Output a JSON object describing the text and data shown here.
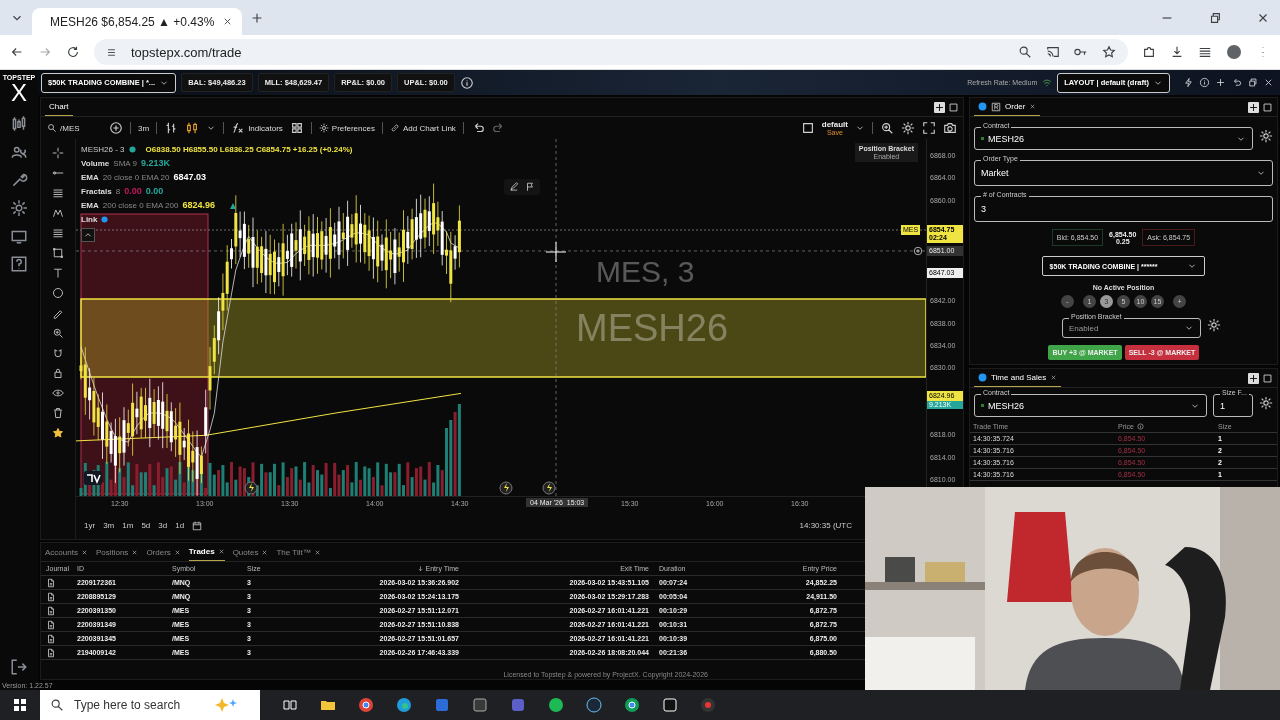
{
  "browser": {
    "tab": {
      "title": "MESH26 $6,854.25 ▲ +0.43%",
      "selected": true
    },
    "url": "topstepx.com/trade"
  },
  "topbar": {
    "logo_word": "TOPSTEP",
    "logo_letter": "X",
    "account": "$50K TRADING COMBINE | *...",
    "stats": [
      "BAL: $49,486.23",
      "MLL: $48,629.47",
      "RP&L: $0.00",
      "UP&L: $0.00"
    ],
    "refresh_rate": "Refresh Rate: Medium",
    "layout": "LAYOUT | default (draft)"
  },
  "chart": {
    "tab": {
      "label": "Chart",
      "selected": true
    },
    "symbol": "/MES",
    "interval": "3m",
    "indicators_button": "Indicators",
    "preferences_button": "Preferences",
    "chart_link_button": "Add Chart Link",
    "template": "default",
    "template_action": "Save",
    "title": "MESH26 - 3",
    "ohlc": "O6838.50 H6855.50 L6836.25 C6854.75 +16.25 (+0.24%)",
    "studies": [
      {
        "name": "Volume",
        "params": "SMA 9",
        "values": [
          {
            "text": "9.213K",
            "color": "#26a69a"
          }
        ]
      },
      {
        "name": "EMA",
        "params": "20 close 0 EMA 20",
        "values": [
          {
            "text": "6847.03",
            "color": "#ffffff"
          }
        ]
      },
      {
        "name": "Fractals",
        "params": "8",
        "values": [
          {
            "text": "0.00",
            "color": "#c2185b"
          },
          {
            "text": "0.00",
            "color": "#26a69a"
          }
        ]
      },
      {
        "name": "EMA",
        "params": "200 close 0 EMA 200",
        "values": [
          {
            "text": "6824.96",
            "color": "#f0e442"
          }
        ]
      }
    ],
    "link": "Link",
    "watermark": [
      "MES, 3",
      "MESH26"
    ],
    "bracket_title": "Position Bracket",
    "bracket_state": "Enabled",
    "price_ticks": [
      "6868.00",
      "6864.00",
      "6860.00",
      "6842.00",
      "6838.00",
      "6834.00",
      "6830.00",
      "6818.00",
      "6814.00",
      "6810.00"
    ],
    "price_tags": [
      {
        "kind": "last",
        "text": "6854.75",
        "sub": "02:24",
        "badge": "MES"
      },
      {
        "kind": "crosshair",
        "text": "6851.00"
      },
      {
        "kind": "ema",
        "text": "6847.03"
      },
      {
        "kind": "volume",
        "text": "6824.96",
        "sub": "9.213K"
      }
    ],
    "time_ticks": [
      "12:30",
      "13:00",
      "13:30",
      "14:00",
      "14:30",
      "15:30",
      "16:00",
      "16:30"
    ],
    "crosshair_time": "04 Mar '26  15:03",
    "ranges": [
      "1yr",
      "3m",
      "1m",
      "5d",
      "3d",
      "1d"
    ],
    "clock": "14:30:35 (UTC"
  },
  "order": {
    "tab": {
      "label": "Order",
      "selected": true
    },
    "contract_label": "Contract",
    "contract": "MESH26",
    "order_type_label": "Order Type",
    "order_type": "Market",
    "qty_label": "# of Contracts",
    "qty": "3",
    "bid": "Bid: 6,854.50",
    "last": "6,854.50",
    "spread": "0.25",
    "ask": "Ask: 6,854.75",
    "account": "$50K TRADING COMBINE | ******",
    "position": "No Active Position",
    "chips": [
      {
        "label": "-",
        "kind": "step",
        "selected": false
      },
      {
        "label": "1",
        "kind": "size",
        "selected": false
      },
      {
        "label": "3",
        "kind": "size",
        "selected": true
      },
      {
        "label": "5",
        "kind": "size",
        "selected": false
      },
      {
        "label": "10",
        "kind": "size",
        "selected": false
      },
      {
        "label": "15",
        "kind": "size",
        "selected": false
      },
      {
        "label": "+",
        "kind": "step",
        "selected": false
      }
    ],
    "bracket_label": "Position Bracket",
    "bracket": "Enabled",
    "buy": "BUY +3 @ MARKET",
    "sell": "SELL -3 @ MARKET"
  },
  "time_sales": {
    "tab": {
      "label": "Time and Sales",
      "selected": true
    },
    "contract_label": "Contract",
    "contract": "MESH26",
    "size_label": "Size F...",
    "size": "1",
    "columns": [
      "Trade Time",
      "Price",
      "Size"
    ],
    "rows": [
      [
        "14:30:35.724",
        "6,854.50",
        "1"
      ],
      [
        "14:30:35.716",
        "6,854.50",
        "2"
      ],
      [
        "14:30:35.716",
        "6,854.50",
        "2"
      ],
      [
        "14:30:35.716",
        "6,854.50",
        "1"
      ]
    ]
  },
  "bottom": {
    "tabs": [
      {
        "label": "Accounts",
        "selected": false
      },
      {
        "label": "Positions",
        "selected": false
      },
      {
        "label": "Orders",
        "selected": false
      },
      {
        "label": "Trades",
        "selected": true
      },
      {
        "label": "Quotes",
        "selected": false
      },
      {
        "label": "The Tilt™",
        "selected": false
      }
    ],
    "journal_column": "Journal",
    "columns": [
      "ID",
      "Symbol",
      "Size",
      "Entry Time",
      "Exit Time",
      "Duration",
      "Entry Price"
    ],
    "rows": [
      [
        "2209172361",
        "/MNQ",
        "3",
        "2026-03-02 15:36:26.902",
        "2026-03-02 15:43:51.105",
        "00:07:24",
        "24,852.25"
      ],
      [
        "2208895129",
        "/MNQ",
        "3",
        "2026-03-02 15:24:13.175",
        "2026-03-02 15:29:17.283",
        "00:05:04",
        "24,911.50"
      ],
      [
        "2200391350",
        "/MES",
        "3",
        "2026-02-27 15:51:12.071",
        "2026-02-27 16:01:41.221",
        "00:10:29",
        "6,872.75"
      ],
      [
        "2200391349",
        "/MES",
        "3",
        "2026-02-27 15:51:10.838",
        "2026-02-27 16:01:41.221",
        "00:10:31",
        "6,872.75"
      ],
      [
        "2200391345",
        "/MES",
        "3",
        "2026-02-27 15:51:01.657",
        "2026-02-27 16:01:41.221",
        "00:10:39",
        "6,875.00"
      ],
      [
        "2194009142",
        "/MES",
        "3",
        "2026-02-26 17:46:43.339",
        "2026-02-26 18:08:20.044",
        "00:21:36",
        "6,880.50"
      ]
    ],
    "version": "Version: 1.22.57",
    "license": "Licensed to Topstep & powered by ProjectX. Copyright 2024-2026"
  },
  "taskbar": {
    "search_placeholder": "Type here to search"
  }
}
